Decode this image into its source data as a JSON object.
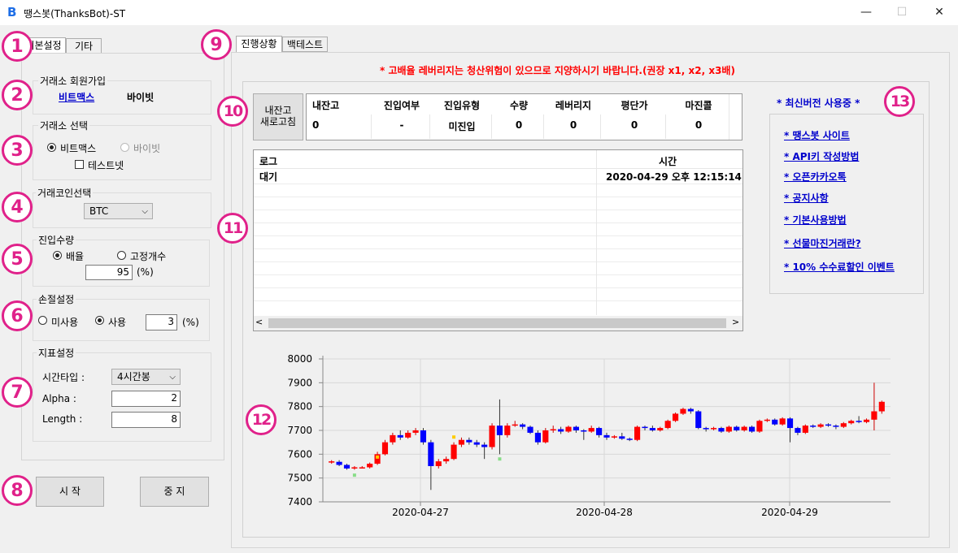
{
  "window": {
    "title": "땡스봇(ThanksBot)-ST",
    "minimize": "—",
    "maximize": "☐",
    "close": "✕"
  },
  "left_tabs": [
    "기본설정",
    "기타"
  ],
  "exchange_signup": {
    "label": "거래소 회원가입",
    "links": [
      "비트맥스",
      "바이빗"
    ]
  },
  "exchange_select": {
    "label": "거래소 선택",
    "options": [
      "비트맥스",
      "바이빗"
    ],
    "selected": "비트맥스",
    "testnet": "테스트넷"
  },
  "coin_select": {
    "label": "거래코인선택",
    "value": "BTC"
  },
  "entry_amount": {
    "label": "진입수량",
    "options": [
      "배율",
      "고정개수"
    ],
    "selected": "배율",
    "value": "95",
    "unit": "(%)"
  },
  "stop_loss": {
    "label": "손절설정",
    "options": [
      "미사용",
      "사용"
    ],
    "selected": "사용",
    "value": "3",
    "unit": "(%)"
  },
  "indicator": {
    "label": "지표설정",
    "timeframe_label": "시간타입 :",
    "timeframe": "4시간봉",
    "alpha_label": "Alpha :",
    "alpha": "2",
    "length_label": "Length :",
    "length": "8"
  },
  "buttons": {
    "start": "시 작",
    "stop": "중 지"
  },
  "right_tabs": [
    "진행상황",
    "백테스트"
  ],
  "warning": "* 고배율 레버리지는 청산위험이 있으므로 지양하시기 바랍니다.(권장 x1, x2, x3배)",
  "refresh_button": [
    "내잔고",
    "새로고침"
  ],
  "status_table": {
    "headers": [
      "내잔고",
      "진입여부",
      "진입유형",
      "수량",
      "레버리지",
      "평단가",
      "마진콜"
    ],
    "values": [
      "0",
      "-",
      "미진입",
      "0",
      "0",
      "0",
      "0"
    ]
  },
  "log_table": {
    "headers": [
      "로그",
      "시간"
    ],
    "rows": [
      [
        "대기",
        "2020-04-29 오후 12:15:14"
      ]
    ]
  },
  "version_notice": "* 최신버전 사용중 *",
  "links": [
    "* 땡스봇 사이트",
    "* API키 작성방법",
    "* 오픈카카오톡",
    "* 공지사항",
    "* 기본사용방법",
    "* 선물마진거래란?",
    "* 10% 수수료할인 이벤트"
  ],
  "badges": [
    "1",
    "2",
    "3",
    "4",
    "5",
    "6",
    "7",
    "8",
    "9",
    "10",
    "11",
    "12",
    "13"
  ],
  "colors": {
    "up": "#ff0000",
    "down": "#0000ff",
    "warning": "#ff0000",
    "link": "#0000cc",
    "badge": "#e0218a"
  },
  "chart_data": {
    "type": "candlestick",
    "y_ticks": [
      "8000",
      "7900",
      "7800",
      "7700",
      "7600",
      "7500",
      "7400"
    ],
    "ylim": [
      7400,
      8000
    ],
    "x_ticks": [
      "2020-04-27",
      "2020-04-28",
      "2020-04-29"
    ],
    "candles": [
      [
        7570,
        7570,
        7560,
        7575
      ],
      [
        7568,
        7555,
        7550,
        7575
      ],
      [
        7555,
        7540,
        7535,
        7560
      ],
      [
        7540,
        7545,
        7535,
        7550
      ],
      [
        7545,
        7545,
        7540,
        7550
      ],
      [
        7545,
        7560,
        7540,
        7565
      ],
      [
        7560,
        7600,
        7555,
        7610
      ],
      [
        7600,
        7650,
        7595,
        7660
      ],
      [
        7650,
        7680,
        7640,
        7690
      ],
      [
        7680,
        7670,
        7660,
        7700
      ],
      [
        7670,
        7690,
        7665,
        7700
      ],
      [
        7690,
        7700,
        7680,
        7710
      ],
      [
        7700,
        7650,
        7640,
        7710
      ],
      [
        7650,
        7550,
        7450,
        7660
      ],
      [
        7550,
        7570,
        7540,
        7580
      ],
      [
        7570,
        7580,
        7560,
        7590
      ],
      [
        7580,
        7640,
        7575,
        7650
      ],
      [
        7640,
        7660,
        7630,
        7670
      ],
      [
        7660,
        7650,
        7640,
        7670
      ],
      [
        7650,
        7640,
        7630,
        7660
      ],
      [
        7640,
        7630,
        7580,
        7650
      ],
      [
        7630,
        7720,
        7620,
        7730
      ],
      [
        7720,
        7680,
        7600,
        7830
      ],
      [
        7680,
        7720,
        7670,
        7730
      ],
      [
        7720,
        7725,
        7715,
        7740
      ],
      [
        7725,
        7715,
        7705,
        7730
      ],
      [
        7715,
        7690,
        7685,
        7720
      ],
      [
        7690,
        7650,
        7640,
        7700
      ],
      [
        7650,
        7700,
        7645,
        7710
      ],
      [
        7700,
        7705,
        7690,
        7720
      ],
      [
        7705,
        7695,
        7685,
        7715
      ],
      [
        7695,
        7715,
        7690,
        7720
      ],
      [
        7715,
        7700,
        7690,
        7720
      ],
      [
        7700,
        7695,
        7660,
        7705
      ],
      [
        7695,
        7710,
        7690,
        7720
      ],
      [
        7710,
        7680,
        7670,
        7715
      ],
      [
        7680,
        7670,
        7660,
        7690
      ],
      [
        7670,
        7675,
        7665,
        7680
      ],
      [
        7675,
        7665,
        7660,
        7690
      ],
      [
        7665,
        7660,
        7655,
        7670
      ],
      [
        7660,
        7715,
        7655,
        7720
      ],
      [
        7715,
        7710,
        7700,
        7720
      ],
      [
        7710,
        7700,
        7695,
        7720
      ],
      [
        7700,
        7710,
        7695,
        7715
      ],
      [
        7710,
        7740,
        7705,
        7745
      ],
      [
        7740,
        7770,
        7735,
        7775
      ],
      [
        7770,
        7790,
        7765,
        7795
      ],
      [
        7790,
        7780,
        7770,
        7795
      ],
      [
        7780,
        7710,
        7705,
        7785
      ],
      [
        7710,
        7705,
        7695,
        7715
      ],
      [
        7705,
        7710,
        7700,
        7715
      ],
      [
        7710,
        7695,
        7690,
        7715
      ],
      [
        7695,
        7715,
        7690,
        7720
      ],
      [
        7715,
        7700,
        7695,
        7720
      ],
      [
        7700,
        7715,
        7695,
        7720
      ],
      [
        7715,
        7695,
        7690,
        7720
      ],
      [
        7695,
        7740,
        7690,
        7745
      ],
      [
        7740,
        7745,
        7735,
        7750
      ],
      [
        7745,
        7725,
        7720,
        7750
      ],
      [
        7725,
        7750,
        7720,
        7755
      ],
      [
        7750,
        7710,
        7650,
        7755
      ],
      [
        7710,
        7690,
        7680,
        7715
      ],
      [
        7690,
        7720,
        7685,
        7725
      ],
      [
        7720,
        7715,
        7710,
        7725
      ],
      [
        7715,
        7725,
        7710,
        7730
      ],
      [
        7725,
        7720,
        7715,
        7730
      ],
      [
        7720,
        7715,
        7705,
        7725
      ],
      [
        7715,
        7730,
        7710,
        7735
      ],
      [
        7730,
        7740,
        7725,
        7745
      ],
      [
        7740,
        7735,
        7730,
        7760
      ],
      [
        7735,
        7745,
        7730,
        7750
      ],
      [
        7745,
        7780,
        7700,
        7900
      ],
      [
        7780,
        7820,
        7770,
        7825
      ]
    ]
  }
}
